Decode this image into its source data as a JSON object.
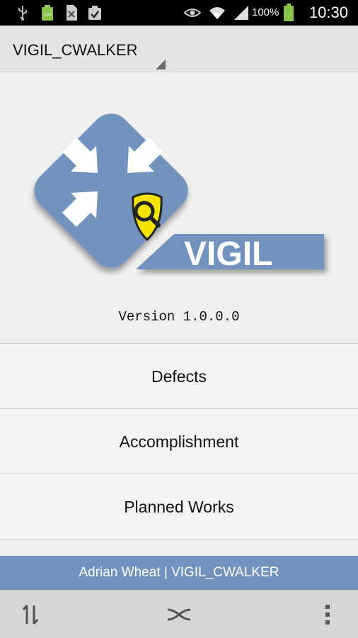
{
  "status_bar": {
    "battery_text": "100%",
    "time": "10:30"
  },
  "action_bar": {
    "account_name": "VIGIL_CWALKER"
  },
  "logo": {
    "wordmark": "VIGIL",
    "color": "#7393bf"
  },
  "version_text": "Version 1.0.0.0",
  "menu": {
    "items": [
      {
        "label": "Defects"
      },
      {
        "label": "Accomplishment"
      },
      {
        "label": "Planned Works"
      }
    ]
  },
  "user_bar": {
    "text": "Adrian Wheat | VIGIL_CWALKER",
    "color": "#7393bf"
  },
  "bottom_bar": {
    "icons": [
      "sync-arrows-icon",
      "connection-icon",
      "overflow-menu-icon"
    ]
  }
}
